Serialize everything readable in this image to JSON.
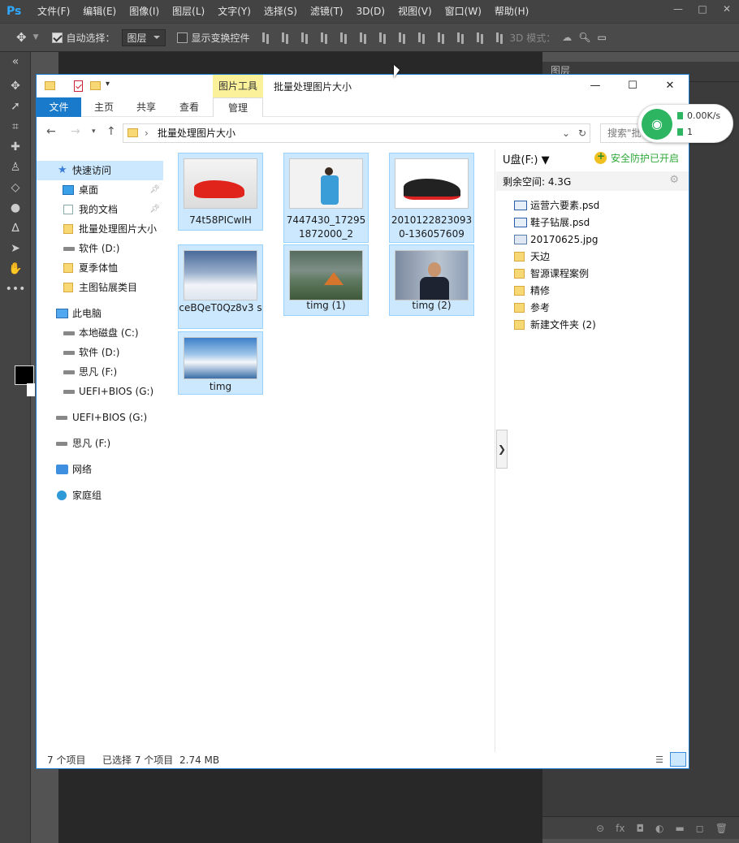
{
  "ps": {
    "logo": "Ps",
    "menu": [
      "文件(F)",
      "编辑(E)",
      "图像(I)",
      "图层(L)",
      "文字(Y)",
      "选择(S)",
      "滤镜(T)",
      "3D(D)",
      "视图(V)",
      "窗口(W)",
      "帮助(H)"
    ],
    "window_controls": [
      "—",
      "□",
      "✕"
    ],
    "options": {
      "auto_select_label": "自动选择：",
      "auto_select_checked": true,
      "auto_select_target": "图层",
      "show_transform_label": "显示变换控件",
      "show_transform_checked": false,
      "mode_label": "3D 模式："
    },
    "panel_tab": "图层"
  },
  "explorer": {
    "context_tab": "图片工具",
    "title": "批量处理图片大小",
    "ribbon_tabs": [
      "文件",
      "主页",
      "共享",
      "查看",
      "管理"
    ],
    "address": "批量处理图片大小",
    "search_placeholder": "搜索\"批...",
    "nav": [
      {
        "label": "快速访问",
        "icon": "star-icon",
        "type": "header",
        "selected": true
      },
      {
        "label": "桌面",
        "icon": "desktop-icon",
        "pinned": true
      },
      {
        "label": "我的文档",
        "icon": "document-icon",
        "pinned": true
      },
      {
        "label": "批量处理图片大小",
        "icon": "folder-icon"
      },
      {
        "label": "软件 (D:)",
        "icon": "drive-icon"
      },
      {
        "label": "夏季体恤",
        "icon": "folder-icon"
      },
      {
        "label": "主图钻展类目",
        "icon": "folder-icon"
      },
      {
        "label": "此电脑",
        "icon": "computer-icon",
        "type": "header"
      },
      {
        "label": "本地磁盘 (C:)",
        "icon": "drive-icon"
      },
      {
        "label": "软件 (D:)",
        "icon": "drive-icon"
      },
      {
        "label": "思凡 (F:)",
        "icon": "drive-icon"
      },
      {
        "label": "UEFI+BIOS (G:)",
        "icon": "drive-icon"
      },
      {
        "label": "UEFI+BIOS (G:)",
        "icon": "usb-drive-icon",
        "type": "header"
      },
      {
        "label": "思凡 (F:)",
        "icon": "usb-drive-icon",
        "type": "header"
      },
      {
        "label": "网络",
        "icon": "network-icon",
        "type": "header"
      },
      {
        "label": "家庭组",
        "icon": "homegroup-icon",
        "type": "header"
      }
    ],
    "files": [
      {
        "name": "74t58PICwIH",
        "thumb": "red-sneaker"
      },
      {
        "name": "7447430_17295 1872000_2",
        "thumb": "woman-blue-dress"
      },
      {
        "name": "2010122823093 0-136057609",
        "thumb": "black-sneaker"
      },
      {
        "name": "ceBQeT0Qz8v3 s",
        "thumb": "snowy-village"
      },
      {
        "name": "timg (1)",
        "thumb": "lake-tent"
      },
      {
        "name": "timg (2)",
        "thumb": "man-in-suit"
      },
      {
        "name": "timg",
        "thumb": "snowy-mountains"
      }
    ],
    "right_pane": {
      "drive": "U盘(F:) ▼",
      "security": "安全防护已开启",
      "free_space": "剩余空间: 4.3G",
      "items": [
        {
          "name": "运营六要素.psd",
          "icon": "psd-file-icon"
        },
        {
          "name": "鞋子钻展.psd",
          "icon": "psd-file-icon"
        },
        {
          "name": "20170625.jpg",
          "icon": "jpg-file-icon"
        },
        {
          "name": "天边",
          "icon": "folder-icon"
        },
        {
          "name": "智源课程案例",
          "icon": "folder-icon"
        },
        {
          "name": "精修",
          "icon": "folder-icon"
        },
        {
          "name": "参考",
          "icon": "folder-icon"
        },
        {
          "name": "新建文件夹 (2)",
          "icon": "folder-icon"
        }
      ]
    },
    "status": {
      "count": "7 个项目",
      "selected": "已选择 7 个项目",
      "size": "2.74 MB"
    }
  },
  "wifi": {
    "speed": "0.00K/s",
    "devices": "1"
  }
}
